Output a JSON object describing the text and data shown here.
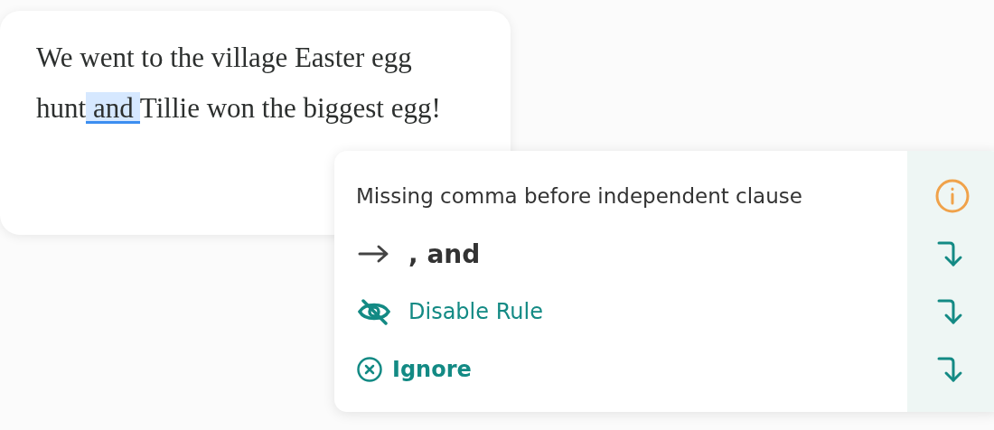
{
  "editor": {
    "segments": [
      {
        "text": "We went to the village Easter egg hunt",
        "highlighted": false
      },
      {
        "text": " and ",
        "highlighted": true
      },
      {
        "text": "Tillie won the biggest egg!",
        "highlighted": false
      }
    ]
  },
  "popup": {
    "message": "Missing comma before independent clause",
    "actions": [
      {
        "kind": "suggestion",
        "label": ", and"
      },
      {
        "kind": "disable",
        "label": "Disable Rule"
      },
      {
        "kind": "ignore",
        "label": "Ignore"
      }
    ]
  }
}
